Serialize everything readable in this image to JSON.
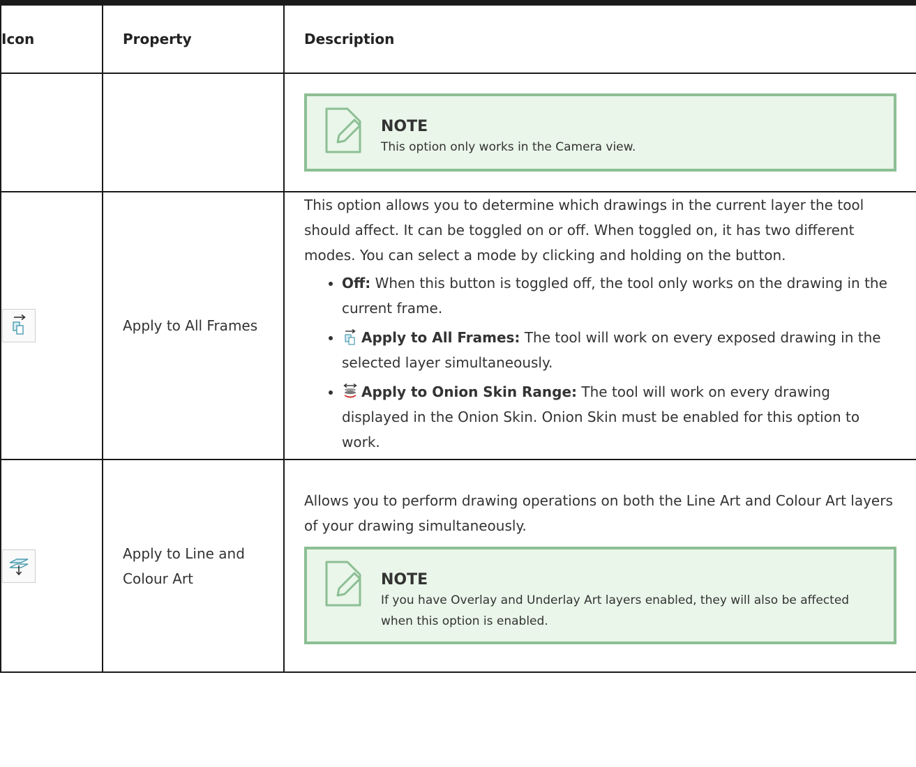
{
  "headers": {
    "icon": "Icon",
    "property": "Property",
    "description": "Description"
  },
  "rows": [
    {
      "property": "",
      "note": {
        "title": "NOTE",
        "text": "This option only works in the Camera view."
      }
    },
    {
      "icon": "apply-to-all-frames-icon",
      "property": "Apply to All Frames",
      "description": "This option allows you to determine which drawings in the current layer the tool should affect. It can be toggled on or off. When toggled on, it has two different modes. You can select a mode by clicking and holding on the button.",
      "modes": [
        {
          "label": "Off:",
          "text": "When this button is toggled off, the tool only works on the drawing in the current frame."
        },
        {
          "icon": "apply-to-all-frames-icon",
          "label": "Apply to All Frames:",
          "text": "The tool will work on every exposed drawing in the selected layer simultaneously."
        },
        {
          "icon": "onion-skin-range-icon",
          "label": "Apply to Onion Skin Range:",
          "text": "The tool will work on every drawing displayed in the Onion Skin. Onion Skin must be enabled for this option to work."
        }
      ]
    },
    {
      "icon": "line-and-colour-art-icon",
      "property": "Apply to Line and Colour Art",
      "description": "Allows you to perform drawing operations on both the Line Art and Colour Art layers of your drawing simultaneously.",
      "note": {
        "title": "NOTE",
        "text": "If you have Overlay and Underlay Art layers enabled, they will also be affected when this option is enabled."
      }
    }
  ],
  "colors": {
    "note_border": "#8cbf94",
    "note_bg": "#eaf6ea",
    "icon_accent": "#4a9bb0",
    "onion_red": "#d0342c"
  }
}
